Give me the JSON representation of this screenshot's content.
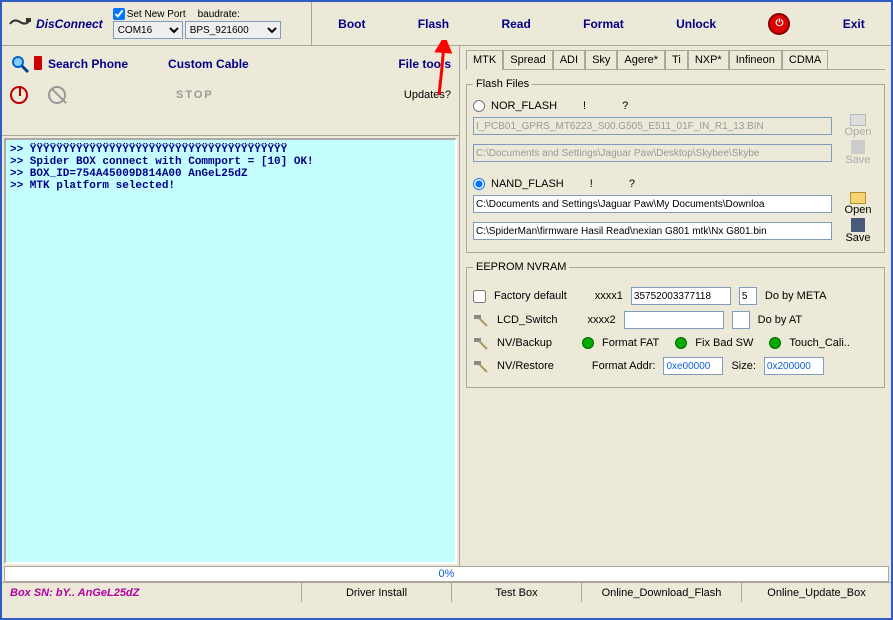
{
  "toolbar": {
    "disconnect": "DisConnect",
    "set_new_port": "Set New Port",
    "baudrate_lbl": "baudrate:",
    "port": "COM16",
    "baud": "BPS_921600",
    "tabs": [
      "Boot",
      "Flash",
      "Read",
      "Format",
      "Unlock"
    ],
    "exit": "Exit"
  },
  "left": {
    "search": "Search Phone",
    "cable": "Custom Cable",
    "filetools": "File tools",
    "stop": "STOP",
    "updates": "Updates?"
  },
  "log": ">> ŸŸŸŸŸŸŸŸŸŸŸŸŸŸŸŸŸŸŸŸŸŸŸŸŸŸŸŸŸŸŸŸŸŸŸŸŸŸŸ\n>> Spider BOX connect with Commport = [10] OK!\n>> BOX_ID=754A45009D814A00 AnGeL25dZ\n>> MTK platform selected!",
  "subtabs": [
    "MTK",
    "Spread",
    "ADI",
    "Sky",
    "Agere*",
    "Ti",
    "NXP*",
    "Infineon",
    "CDMA"
  ],
  "flashfiles": {
    "legend": "Flash Files",
    "nor": "NOR_FLASH",
    "nand": "NAND_FLASH",
    "q1": "!",
    "q2": "?",
    "nor_path1": "I_PCB01_GPRS_MT6223_S00.G505_E511_01F_IN_R1_13.BIN",
    "nor_path2": "C:\\Documents and Settings\\Jaguar Paw\\Desktop\\Skybee\\Skybe",
    "nand_path1": "C:\\Documents and Settings\\Jaguar Paw\\My Documents\\Downloa",
    "nand_path2": "C:\\SpiderMan\\firmware Hasil Read\\nexian G801 mtk\\Nx G801.bin",
    "open": "Open",
    "save": "Save"
  },
  "eeprom": {
    "legend": "EEPROM NVRAM",
    "factory": "Factory default",
    "xxxx1": "xxxx1",
    "xxxx2": "xxxx2",
    "val1": "35752003377118",
    "val1n": "5",
    "do_meta": "Do by META",
    "do_at": "Do by AT",
    "lcd": "LCD_Switch",
    "nvbackup": "NV/Backup",
    "nvrestore": "NV/Restore",
    "format_fat": "Format FAT",
    "fix_bad": "Fix Bad SW",
    "touch_cali": "Touch_Cali..",
    "format_addr_lbl": "Format Addr:",
    "format_addr": "0xe00000",
    "size_lbl": "Size:",
    "size": "0x200000"
  },
  "progress": "0%",
  "statusbar": {
    "boxsn": "Box SN: bY.. AnGeL25dZ",
    "driver": "Driver Install",
    "testbox": "Test Box",
    "dlflash": "Online_Download_Flash",
    "upbox": "Online_Update_Box"
  }
}
